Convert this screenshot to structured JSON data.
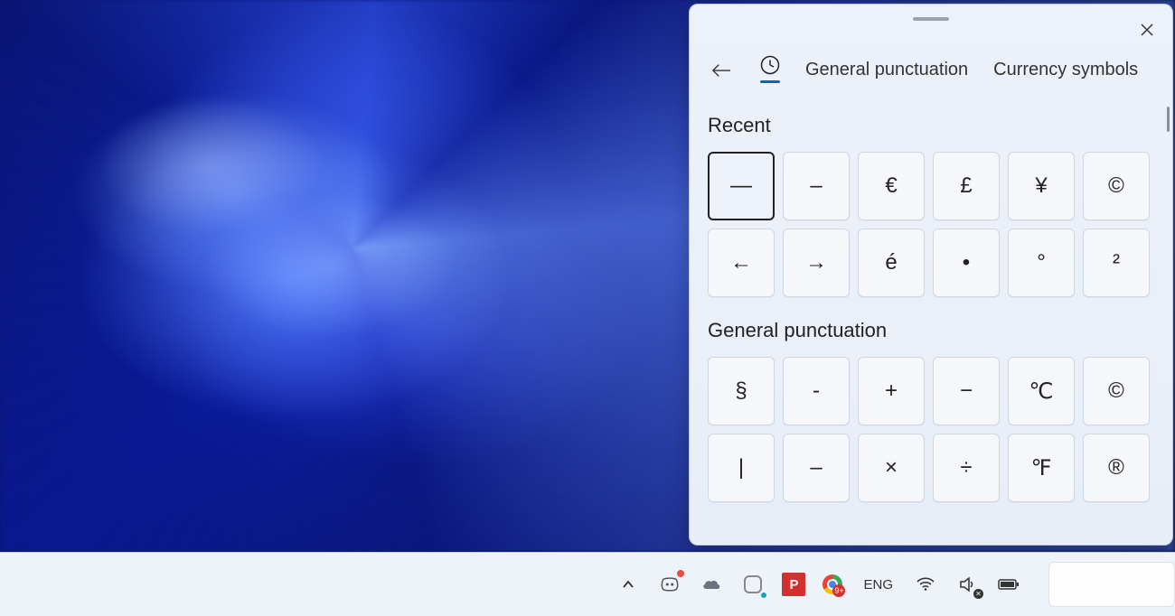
{
  "panel": {
    "tabs": {
      "general_punctuation": "General punctuation",
      "currency_symbols": "Currency symbols"
    },
    "sections": {
      "recent": {
        "title": "Recent",
        "items": [
          "—",
          "–",
          "€",
          "£",
          "¥",
          "©",
          "←",
          "→",
          "é",
          "•",
          "°",
          "²"
        ]
      },
      "general_punctuation": {
        "title": "General punctuation",
        "items": [
          "§",
          "-",
          "+",
          "−",
          "℃",
          "©",
          "|",
          "–",
          "×",
          "÷",
          "℉",
          "®"
        ]
      }
    },
    "selected_index": 0
  },
  "taskbar": {
    "language": "ENG",
    "p_app_label": "P",
    "notification_badge": "9+"
  }
}
